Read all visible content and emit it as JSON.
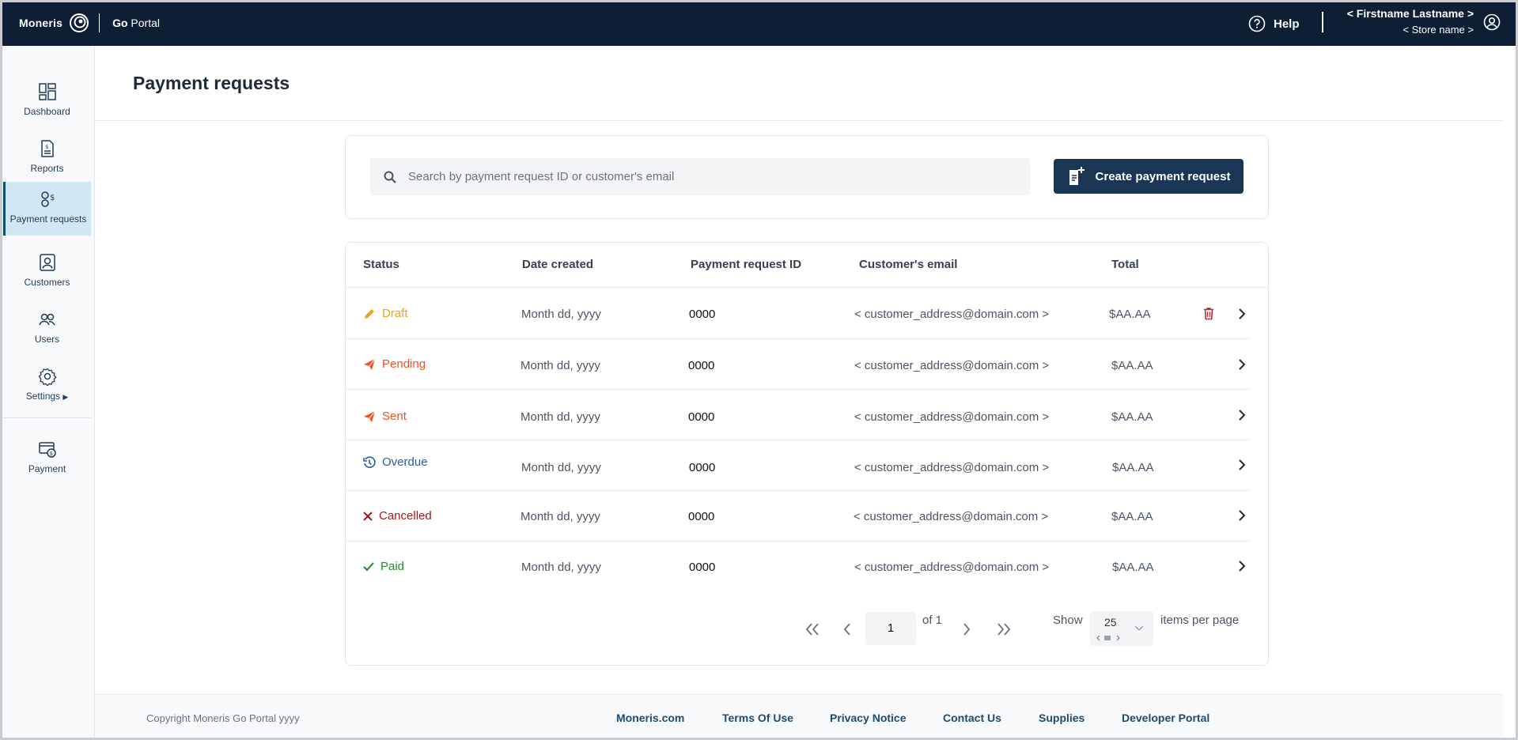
{
  "header": {
    "brand": "Moneris",
    "product_bold": "Go",
    "product_rest": " Portal",
    "help_label": "Help",
    "user_name": "< Firstname Lastname >",
    "store_name": "< Store name >"
  },
  "sidebar": {
    "items": [
      {
        "label": "Dashboard",
        "icon": "dashboard-icon"
      },
      {
        "label": "Reports",
        "icon": "reports-icon"
      },
      {
        "label": "Payment requests",
        "icon": "payment-requests-icon",
        "active": true
      },
      {
        "label": "Customers",
        "icon": "customers-icon"
      },
      {
        "label": "Users",
        "icon": "users-icon"
      },
      {
        "label": "Settings",
        "icon": "gear-icon"
      },
      {
        "label": "Payment",
        "icon": "payment-icon"
      }
    ]
  },
  "page": {
    "title": "Payment requests"
  },
  "search": {
    "placeholder": "Search by payment request ID or customer's email"
  },
  "create_button": "Create payment request",
  "table": {
    "columns": [
      "Status",
      "Date created",
      "Payment request ID",
      "Customer's email",
      "Total"
    ],
    "rows": [
      {
        "status": "Draft",
        "status_color": "#f0a020",
        "date": "Month  dd, yyyy",
        "id": "0000",
        "email": "< customer_address@domain.com >",
        "total": "$AA.AA",
        "deletable": true
      },
      {
        "status": "Pending",
        "status_color": "#f0521f",
        "date": "Month  dd, yyyy",
        "id": "0000",
        "email": "< customer_address@domain.com >",
        "total": "$AA.AA"
      },
      {
        "status": "Sent",
        "status_color": "#f0521f",
        "date": "Month  dd, yyyy",
        "id": "0000",
        "email": "< customer_address@domain.com >",
        "total": "$AA.AA"
      },
      {
        "status": "Overdue",
        "status_color": "#2b5e9a",
        "date": "Month  dd, yyyy",
        "id": "0000",
        "email": "< customer_address@domain.com >",
        "total": "$AA.AA"
      },
      {
        "status": "Cancelled",
        "status_color": "#a01a1a",
        "date": "Month  dd, yyyy",
        "id": "0000",
        "email": "< customer_address@domain.com >",
        "total": "$AA.AA"
      },
      {
        "status": "Paid",
        "status_color": "#1c8a2e",
        "date": "Month  dd, yyyy",
        "id": "0000",
        "email": "< customer_address@domain.com >",
        "total": "$AA.AA"
      }
    ]
  },
  "pagination": {
    "current_page": "1",
    "of_label": "of 1",
    "show_label": "Show",
    "per_page_value": "25",
    "items_per_page_label": "items per page"
  },
  "footer": {
    "copyright": "Copyright Moneris Go Portal  yyyy",
    "links": [
      "Moneris.com",
      "Terms Of Use",
      "Privacy Notice",
      "Contact Us",
      "Supplies",
      "Developer Portal"
    ]
  }
}
